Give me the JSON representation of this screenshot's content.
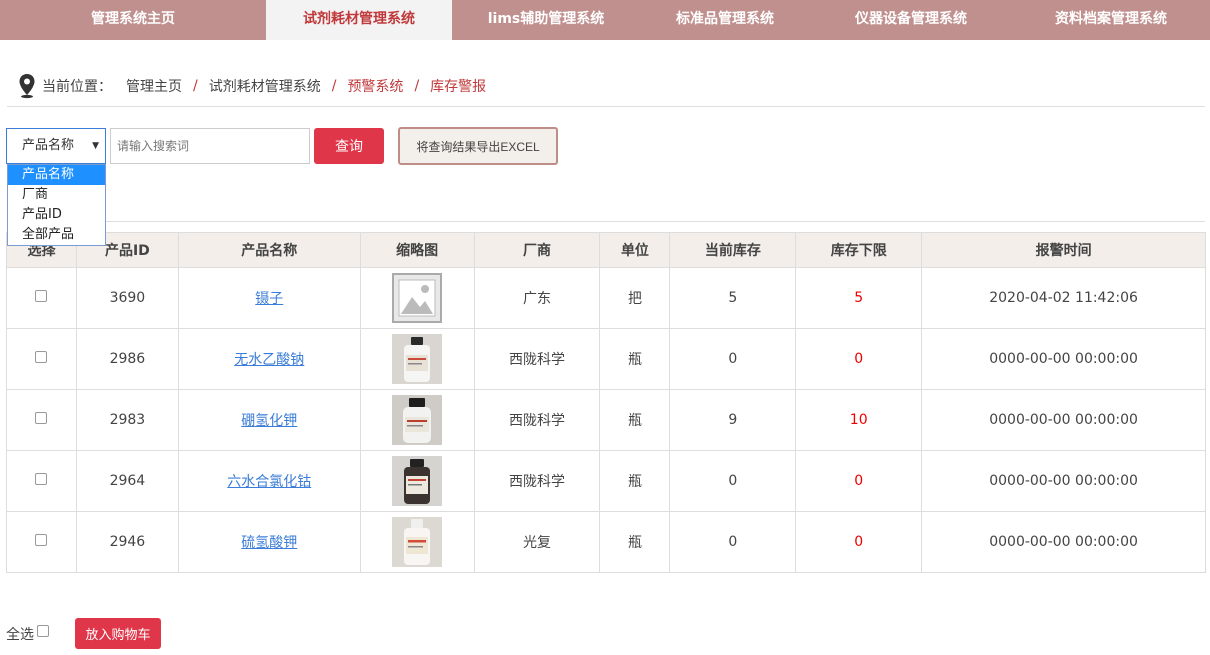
{
  "nav": {
    "tabs": [
      {
        "label": "管理系统主页",
        "active": false
      },
      {
        "label": "试剂耗材管理系统",
        "active": true
      },
      {
        "label": "lims辅助管理系统",
        "active": false
      },
      {
        "label": "标准品管理系统",
        "active": false
      },
      {
        "label": "仪器设备管理系统",
        "active": false
      },
      {
        "label": "资料档案管理系统",
        "active": false
      }
    ]
  },
  "breadcrumb": {
    "label": "当前位置：",
    "items": [
      "管理主页",
      "试剂耗材管理系统",
      "预警系统",
      "库存警报"
    ],
    "separator": "/"
  },
  "search": {
    "field_select_value": "产品名称",
    "field_options": [
      "产品名称",
      "厂商",
      "产品ID",
      "全部产品"
    ],
    "highlighted_option": "产品名称",
    "placeholder": "请输入搜索词",
    "query_label": "查询",
    "export_label": "将查询结果导出EXCEL"
  },
  "table": {
    "headers": [
      "选择",
      "产品ID",
      "产品名称",
      "缩略图",
      "厂商",
      "单位",
      "当前库存",
      "库存下限",
      "报警时间"
    ],
    "rows": [
      {
        "id": "3690",
        "name": "镊子",
        "thumb": "placeholder-image",
        "vendor": "广东",
        "unit": "把",
        "stock": "5",
        "min": "5",
        "time": "2020-04-02 11:42:06"
      },
      {
        "id": "2986",
        "name": "无水乙酸钠",
        "thumb": "reagent-bottle",
        "vendor": "西陇科学",
        "unit": "瓶",
        "stock": "0",
        "min": "0",
        "time": "0000-00-00 00:00:00"
      },
      {
        "id": "2983",
        "name": "硼氢化钾",
        "thumb": "reagent-bottle",
        "vendor": "西陇科学",
        "unit": "瓶",
        "stock": "9",
        "min": "10",
        "time": "0000-00-00 00:00:00"
      },
      {
        "id": "2964",
        "name": "六水合氯化钴",
        "thumb": "dark-reagent-bottle",
        "vendor": "西陇科学",
        "unit": "瓶",
        "stock": "0",
        "min": "0",
        "time": "0000-00-00 00:00:00"
      },
      {
        "id": "2946",
        "name": "硫氢酸钾",
        "thumb": "reagent-bottle",
        "vendor": "光复",
        "unit": "瓶",
        "stock": "0",
        "min": "0",
        "time": "0000-00-00 00:00:00"
      }
    ]
  },
  "footer": {
    "select_all_label": "全选",
    "add_cart_label": "放入购物车"
  },
  "colors": {
    "nav_bg": "#c0908e",
    "accent_red": "#e0364a",
    "link_blue": "#3b7dd8",
    "alert_red": "#e00000"
  }
}
